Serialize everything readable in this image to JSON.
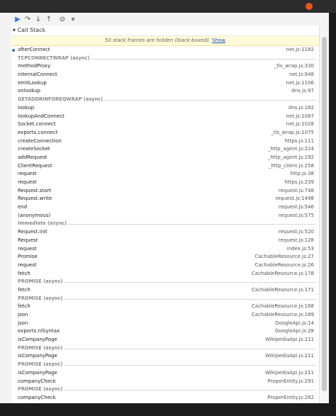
{
  "toolbar": {
    "buttons": [
      {
        "icon": "resume-icon",
        "glyph": "▶"
      },
      {
        "icon": "step-over-icon",
        "glyph": "↷"
      },
      {
        "icon": "step-into-icon",
        "glyph": "↓"
      },
      {
        "icon": "step-out-icon",
        "glyph": "↑"
      },
      {
        "icon": "deactivate-breakpoints-icon",
        "glyph": "⊘"
      },
      {
        "icon": "pause-on-exceptions-icon",
        "glyph": "⏸"
      }
    ]
  },
  "call_stack": {
    "title": "Call Stack",
    "hidden_banner_text": "53 stack frames are hidden (black-boxed).",
    "show_link": "Show",
    "frames": [
      {
        "type": "frame",
        "name": "afterConnect",
        "loc": "net.js:1182",
        "current": true
      },
      {
        "type": "async",
        "name": "TCPCONNECTWRAP (async)"
      },
      {
        "type": "frame",
        "name": "methodProxy",
        "loc": "_tls_wrap.js:330"
      },
      {
        "type": "frame",
        "name": "internalConnect",
        "loc": "net.js:948"
      },
      {
        "type": "frame",
        "name": "emitLookup",
        "loc": "net.js:1106"
      },
      {
        "type": "frame",
        "name": "onlookup",
        "loc": "dns.js:97"
      },
      {
        "type": "async",
        "name": "GETADDRINFOREQWRAP (async)"
      },
      {
        "type": "frame",
        "name": "lookup",
        "loc": "dns.js:182"
      },
      {
        "type": "frame",
        "name": "lookupAndConnect",
        "loc": "net.js:1087"
      },
      {
        "type": "frame",
        "name": "Socket.connect",
        "loc": "net.js:1028"
      },
      {
        "type": "frame",
        "name": "exports.connect",
        "loc": "_tls_wrap.js:1075"
      },
      {
        "type": "frame",
        "name": "createConnection",
        "loc": "https.js:111"
      },
      {
        "type": "frame",
        "name": "createSocket",
        "loc": "_http_agent.js:224"
      },
      {
        "type": "frame",
        "name": "addRequest",
        "loc": "_http_agent.js:192"
      },
      {
        "type": "frame",
        "name": "ClientRequest",
        "loc": "_http_client.js:258"
      },
      {
        "type": "frame",
        "name": "request",
        "loc": "http.js:38"
      },
      {
        "type": "frame",
        "name": "request",
        "loc": "https.js:239"
      },
      {
        "type": "frame",
        "name": "Request.start",
        "loc": "request.js:748"
      },
      {
        "type": "frame",
        "name": "Request.write",
        "loc": "request.js:1498"
      },
      {
        "type": "frame",
        "name": "end",
        "loc": "request.js:546"
      },
      {
        "type": "frame",
        "name": "(anonymous)",
        "loc": "request.js:575"
      },
      {
        "type": "async",
        "name": "Immediate (async)"
      },
      {
        "type": "frame",
        "name": "Request.init",
        "loc": "request.js:520"
      },
      {
        "type": "frame",
        "name": "Request",
        "loc": "request.js:128"
      },
      {
        "type": "frame",
        "name": "request",
        "loc": "index.js:53"
      },
      {
        "type": "frame",
        "name": "Promise",
        "loc": "CachableResource.js:27"
      },
      {
        "type": "frame",
        "name": "request",
        "loc": "CachableResource.js:26"
      },
      {
        "type": "frame",
        "name": "fetch",
        "loc": "CachableResource.js:178"
      },
      {
        "type": "async",
        "name": "PROMISE (async)"
      },
      {
        "type": "frame",
        "name": "fetch",
        "loc": "CachableResource.js:171"
      },
      {
        "type": "async",
        "name": "PROMISE (async)"
      },
      {
        "type": "frame",
        "name": "fetch",
        "loc": "CachableResource.js:168"
      },
      {
        "type": "frame",
        "name": "json",
        "loc": "CachableResource.js:189"
      },
      {
        "type": "frame",
        "name": "json",
        "loc": "GoogleApi.js:14"
      },
      {
        "type": "frame",
        "name": "exports.nlSyntax",
        "loc": "GoogleApi.js:28"
      },
      {
        "type": "frame",
        "name": "isCompanyPage",
        "loc": "WikipediaApi.js:211"
      },
      {
        "type": "async",
        "name": "PROMISE (async)"
      },
      {
        "type": "frame",
        "name": "isCompanyPage",
        "loc": "WikipediaApi.js:211"
      },
      {
        "type": "async",
        "name": "PROMISE (async)"
      },
      {
        "type": "frame",
        "name": "isCompanyPage",
        "loc": "WikipediaApi.js:211"
      },
      {
        "type": "frame",
        "name": "companyCheck",
        "loc": "ProperEntity.js:291"
      },
      {
        "type": "async",
        "name": "PROMISE (async)"
      },
      {
        "type": "frame",
        "name": "companyCheck",
        "loc": "ProperEntity.js:282"
      }
    ]
  }
}
